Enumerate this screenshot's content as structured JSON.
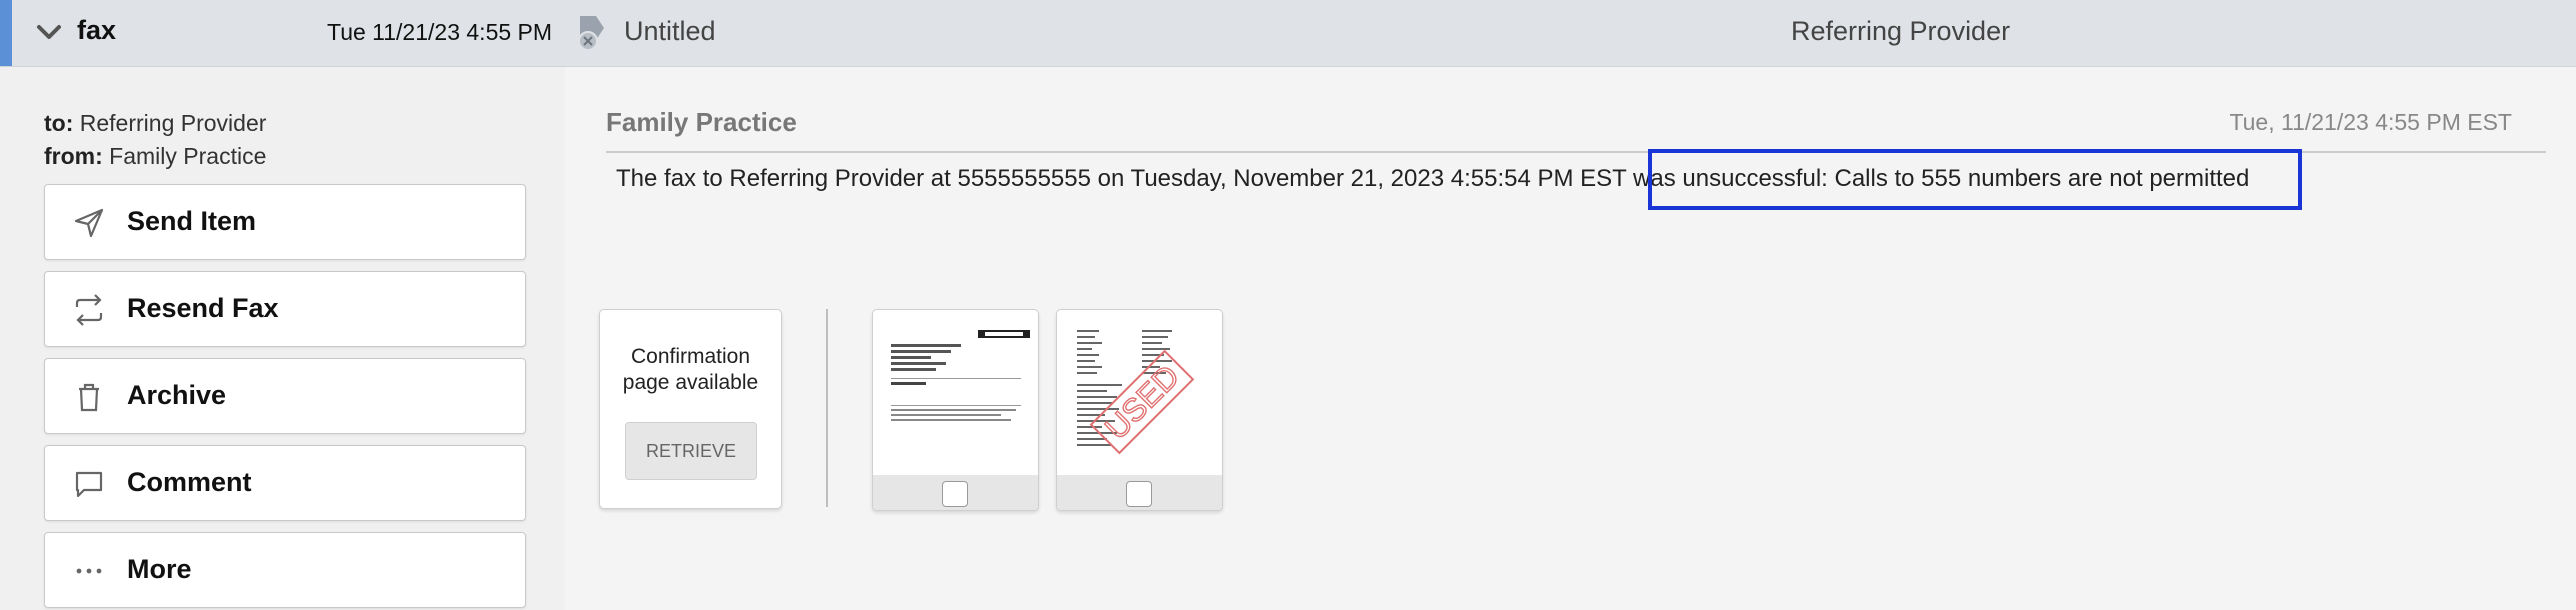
{
  "header": {
    "kind": "fax",
    "date": "Tue 11/21/23 4:55 PM",
    "subject": "Untitled",
    "recipient": "Referring Provider",
    "accent_color": "#5b8fd6"
  },
  "meta": {
    "to_label": "to:",
    "to_value": "Referring Provider",
    "from_label": "from:",
    "from_value": "Family Practice"
  },
  "actions": [
    {
      "label": "Send Item",
      "icon": "send-icon"
    },
    {
      "label": "Resend Fax",
      "icon": "resend-icon"
    },
    {
      "label": "Archive",
      "icon": "trash-icon"
    },
    {
      "label": "Comment",
      "icon": "comment-icon"
    },
    {
      "label": "More",
      "icon": "more-icon"
    }
  ],
  "message": {
    "from": "Family Practice",
    "date": "Tue, 11/21/23 4:55 PM EST",
    "text": "The fax to Referring Provider at 5555555555 on Tuesday, November 21, 2023 4:55:54 PM EST was unsuccessful: Calls to 555 numbers are not permitted",
    "highlight_color": "#1a35d6"
  },
  "confirmation": {
    "text_line1": "Confirmation",
    "text_line2": "page available",
    "button": "RETRIEVE"
  },
  "stamp": {
    "text": "USED",
    "color": "#e07070"
  }
}
